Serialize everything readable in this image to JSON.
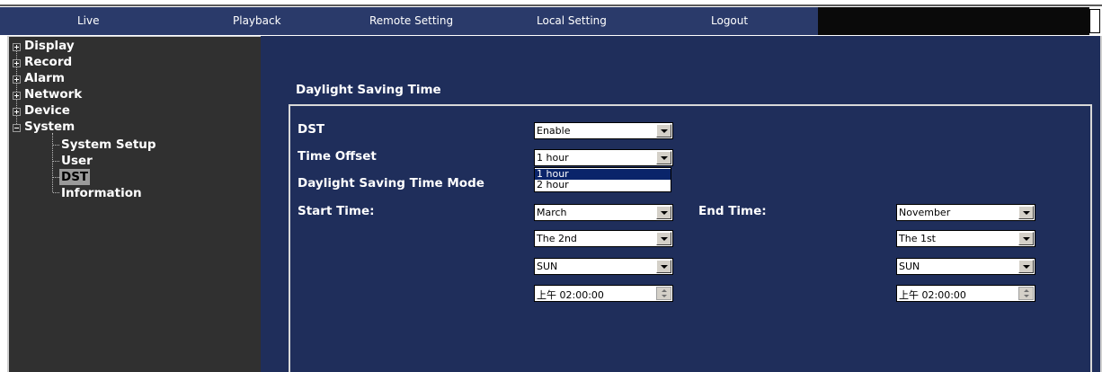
{
  "nav": {
    "items": [
      "Live",
      "Playback",
      "Remote Setting",
      "Local Setting",
      "Logout"
    ]
  },
  "sidebar": {
    "items": [
      {
        "label": "Display",
        "expanded": false
      },
      {
        "label": "Record",
        "expanded": false
      },
      {
        "label": "Alarm",
        "expanded": false
      },
      {
        "label": "Network",
        "expanded": false
      },
      {
        "label": "Device",
        "expanded": false
      },
      {
        "label": "System",
        "expanded": true
      }
    ],
    "system_children": [
      {
        "label": "System Setup",
        "selected": false
      },
      {
        "label": "User",
        "selected": false
      },
      {
        "label": "DST",
        "selected": true
      },
      {
        "label": "Information",
        "selected": false
      }
    ]
  },
  "main": {
    "section_title": "Daylight Saving Time",
    "dst_label": "DST",
    "dst_value": "Enable",
    "offset_label": "Time Offset",
    "offset_value": "1 hour",
    "offset_options": [
      "1 hour",
      "2 hour"
    ],
    "offset_selected_index": 0,
    "mode_label": "Daylight Saving Time Mode",
    "start_label": "Start Time:",
    "end_label": "End Time:",
    "start": {
      "month": "March",
      "week": "The 2nd",
      "day": "SUN",
      "time": "上午 02:00:00"
    },
    "end": {
      "month": "November",
      "week": "The 1st",
      "day": "SUN",
      "time": "上午 02:00:00"
    }
  },
  "colors": {
    "nav_bg": "#2a3a6a",
    "sidebar_bg": "#303030",
    "main_bg": "#1f2e5b",
    "selection": "#0a246a"
  }
}
